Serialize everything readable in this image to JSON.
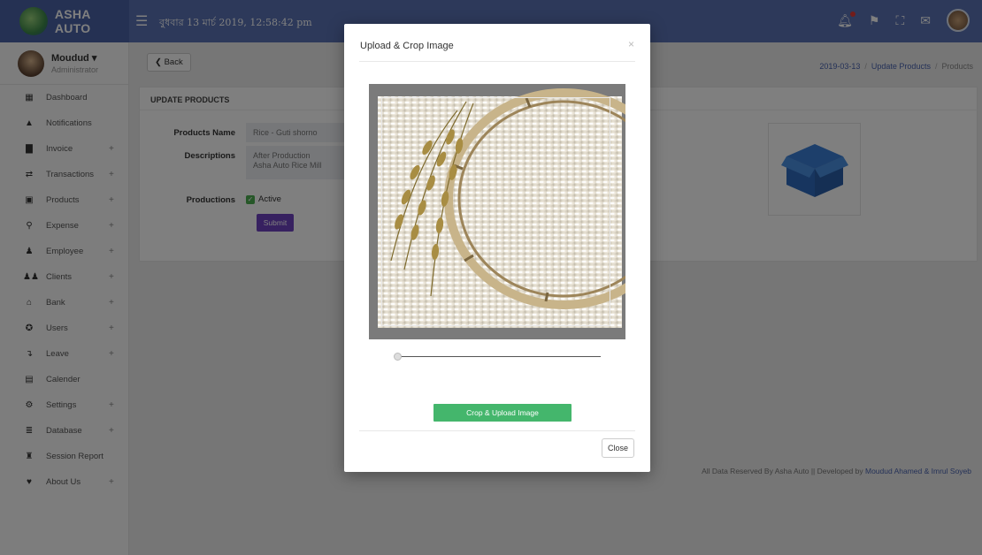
{
  "brand": {
    "name": "ASHA AUTO"
  },
  "topbar": {
    "datetime": "বুধবার 13 মার্চ 2019, 12:58:42 pm"
  },
  "user": {
    "name": "Moudud ▾",
    "role": "Administrator"
  },
  "sidebar": {
    "items": [
      {
        "label": "Dashboard",
        "icon": "dashboard-icon",
        "glyph": "▦",
        "expandable": false
      },
      {
        "label": "Notifications",
        "icon": "bell-icon",
        "glyph": "▲",
        "expandable": false
      },
      {
        "label": "Invoice",
        "icon": "file-icon",
        "glyph": "▇",
        "expandable": true
      },
      {
        "label": "Transactions",
        "icon": "exchange-icon",
        "glyph": "⇄",
        "expandable": true
      },
      {
        "label": "Products",
        "icon": "box-icon",
        "glyph": "▣",
        "expandable": true
      },
      {
        "label": "Expense",
        "icon": "expense-icon",
        "glyph": "⚲",
        "expandable": true
      },
      {
        "label": "Employee",
        "icon": "user-icon",
        "glyph": "♟",
        "expandable": true
      },
      {
        "label": "Clients",
        "icon": "users-icon",
        "glyph": "♟♟",
        "expandable": true
      },
      {
        "label": "Bank",
        "icon": "bank-icon",
        "glyph": "⌂",
        "expandable": true
      },
      {
        "label": "Users",
        "icon": "users-circle-icon",
        "glyph": "✪",
        "expandable": true
      },
      {
        "label": "Leave",
        "icon": "leave-icon",
        "glyph": "↴",
        "expandable": true
      },
      {
        "label": "Calender",
        "icon": "calendar-icon",
        "glyph": "▤",
        "expandable": false
      },
      {
        "label": "Settings",
        "icon": "cogs-icon",
        "glyph": "⚙",
        "expandable": true
      },
      {
        "label": "Database",
        "icon": "database-icon",
        "glyph": "≣",
        "expandable": true
      },
      {
        "label": "Session Report",
        "icon": "report-icon",
        "glyph": "♜",
        "expandable": false
      },
      {
        "label": "About Us",
        "icon": "map-marker-icon",
        "glyph": "♥",
        "expandable": true
      }
    ],
    "plus": "+"
  },
  "toolbar": {
    "back_label": "❮ Back"
  },
  "breadcrumb": {
    "date": "2019-03-13",
    "parent": "Update Products",
    "current": "Products",
    "sep": "/"
  },
  "form": {
    "title": "UPDATE PRODUCTS",
    "name_label": "Products Name",
    "name_value": "Rice - Guti shorno",
    "desc_label": "Descriptions",
    "desc_line1": "After Production",
    "desc_line2": "Asha Auto Rice Mill",
    "prod_label": "Productions",
    "active_label": "Active",
    "active_checked": true,
    "submit_label": "Submit"
  },
  "footer": {
    "text": "All Data Reserved By Asha Auto || Developed by ",
    "authors": "Moudud Ahamed & Imrul Soyeb"
  },
  "modal": {
    "title": "Upload & Crop Image",
    "close_x": "×",
    "zoom_slider": 0,
    "crop_button": "Crop & Upload Image",
    "close_button": "Close"
  },
  "colors": {
    "topbar": "#5a72b4",
    "primary_submit": "#6f42c1",
    "crop_button": "#44b66c",
    "link": "#4a64b0"
  }
}
